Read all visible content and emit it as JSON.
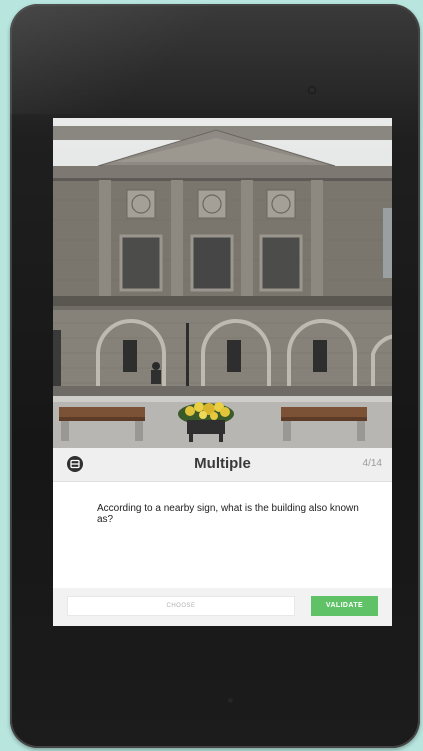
{
  "device": {
    "bezel_color": "#1c1c1c",
    "background_color": "#b8e6df"
  },
  "photo": {
    "subject": "stone-building-facade"
  },
  "quiz": {
    "question_type": "Multiple",
    "counter": "4/14",
    "question_text": "According to a nearby sign, what is the building also known as?",
    "type_icon": "multiple-choice-icon"
  },
  "controls": {
    "choose_label": "CHOOSE",
    "validate_label": "VALIDATE",
    "accent_color": "#5fc267"
  }
}
